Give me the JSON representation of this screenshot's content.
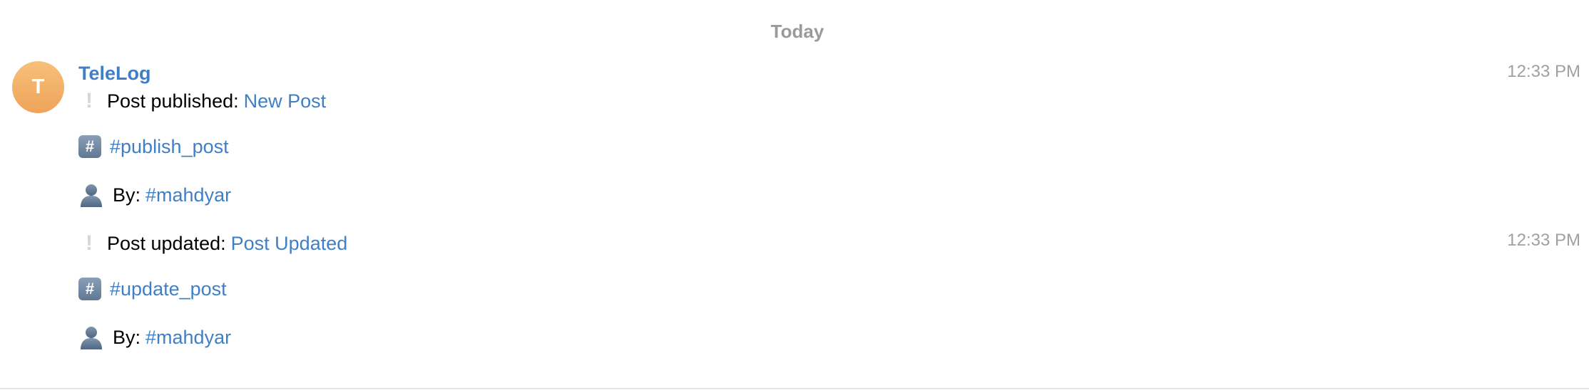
{
  "date_separator": "Today",
  "chat": {
    "sender": "TeleLog",
    "avatar_initial": "T",
    "avatar_colors": [
      "#f6c07b",
      "#efa359"
    ],
    "link_color": "#3f7fc6",
    "messages": [
      {
        "time": "12:33 PM",
        "status_icon": "exclamation-icon",
        "action_label": "Post published: ",
        "title_link": "New Post",
        "hashtag_icon": "hash-keycap-icon",
        "hashtag": "#publish_post",
        "user_icon": "user-silhouette-icon",
        "by_label": "By: ",
        "user_tag": "#mahdyar"
      },
      {
        "time": "12:33 PM",
        "status_icon": "exclamation-icon",
        "action_label": "Post updated: ",
        "title_link": "Post Updated",
        "hashtag_icon": "hash-keycap-icon",
        "hashtag": "#update_post",
        "user_icon": "user-silhouette-icon",
        "by_label": "By: ",
        "user_tag": "#mahdyar"
      }
    ]
  }
}
